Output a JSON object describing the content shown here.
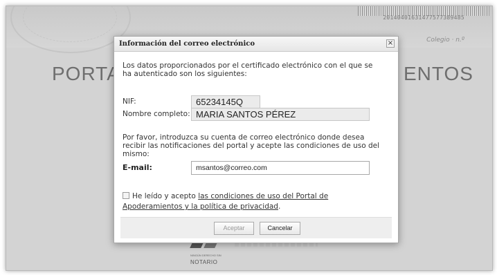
{
  "background": {
    "barcode_text": "20140401631477577389485",
    "header_deco_text": "Colegio · n.º",
    "portal_title_left": "PORTAL",
    "portal_title_right": "ENTOS",
    "logo": {
      "tagline": "NINGÚN DERECHO SIN",
      "name": "NOTARIO"
    }
  },
  "dialog": {
    "title": "Información del correo electrónico",
    "close_label": "×",
    "intro": "Los datos proporcionados por el certificado electrónico con el que se ha autenticado son los siguientes:",
    "nif_label": "NIF:",
    "nif_value": "65234145Q",
    "fullname_label": "Nombre completo:",
    "fullname_value": "MARIA SANTOS PÉREZ",
    "instructions": "Por favor, introduzca su cuenta de correo electrónico donde desea recibir las notificaciones del portal y acepte las condiciones de uso del mismo:",
    "email_label": "E-mail:",
    "email_value": "msantos@correo.com",
    "terms_prefix": "He leído y acepto ",
    "terms_link": "las condiciones de uso del Portal de Apoderamientos y la política de privacidad",
    "terms_suffix": ".",
    "terms_checked": false,
    "accept_label": "Aceptar",
    "cancel_label": "Cancelar"
  },
  "colors": {
    "background_gray": "#d3d3d3",
    "dialog_bg": "#ffffff",
    "disabled_text": "#9a9a9a"
  }
}
